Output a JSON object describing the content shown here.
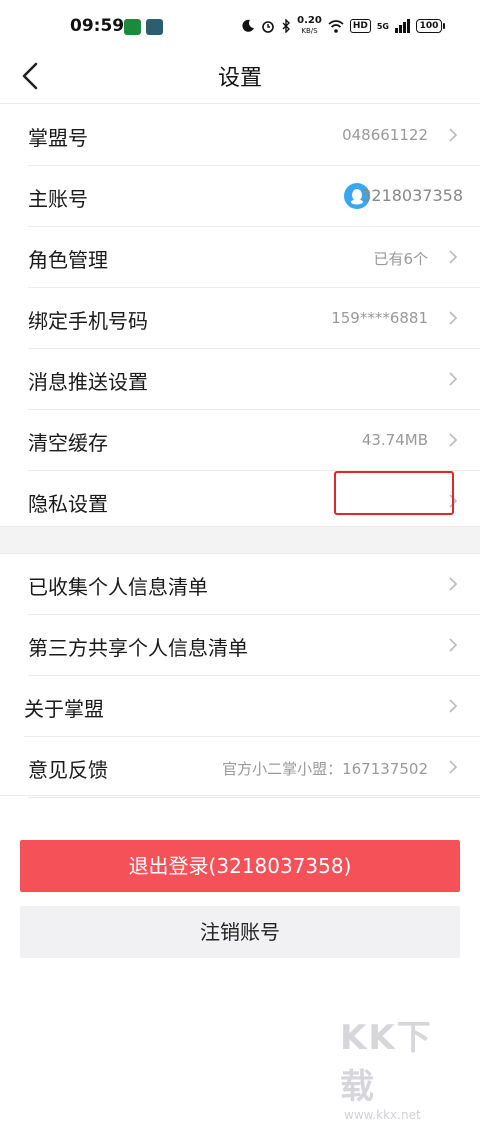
{
  "status_bar": {
    "time": "09:59",
    "net_speed": "0.20",
    "net_unit": "KB/S",
    "hd": "HD",
    "signal": "5G",
    "battery": "100"
  },
  "header": {
    "title": "设置"
  },
  "section1": [
    {
      "label": "掌盟号",
      "value": "048661122"
    },
    {
      "label": "主账号",
      "value": "3218037358"
    },
    {
      "label": "角色管理",
      "value": "已有6个"
    },
    {
      "label": "绑定手机号码",
      "value": "159****6881"
    },
    {
      "label": "消息推送设置",
      "value": ""
    },
    {
      "label": "清空缓存",
      "value": "43.74MB"
    },
    {
      "label": "隐私设置",
      "value": ""
    }
  ],
  "section2": [
    {
      "label": "已收集个人信息清单",
      "value": ""
    },
    {
      "label": "第三方共享个人信息清单",
      "value": ""
    },
    {
      "label": "关于掌盟",
      "value": ""
    },
    {
      "label": "意见反馈",
      "value": "官方小二掌小盟：167137502"
    }
  ],
  "buttons": {
    "logout": "退出登录(3218037358)",
    "cancel_account": "注销账号"
  },
  "watermark": {
    "big": "KK下载",
    "small": "www.kkx.net"
  },
  "colors": {
    "logout_bg": "#f45158",
    "highlight": "#e3262a",
    "qq_blue": "#38a7f0"
  }
}
